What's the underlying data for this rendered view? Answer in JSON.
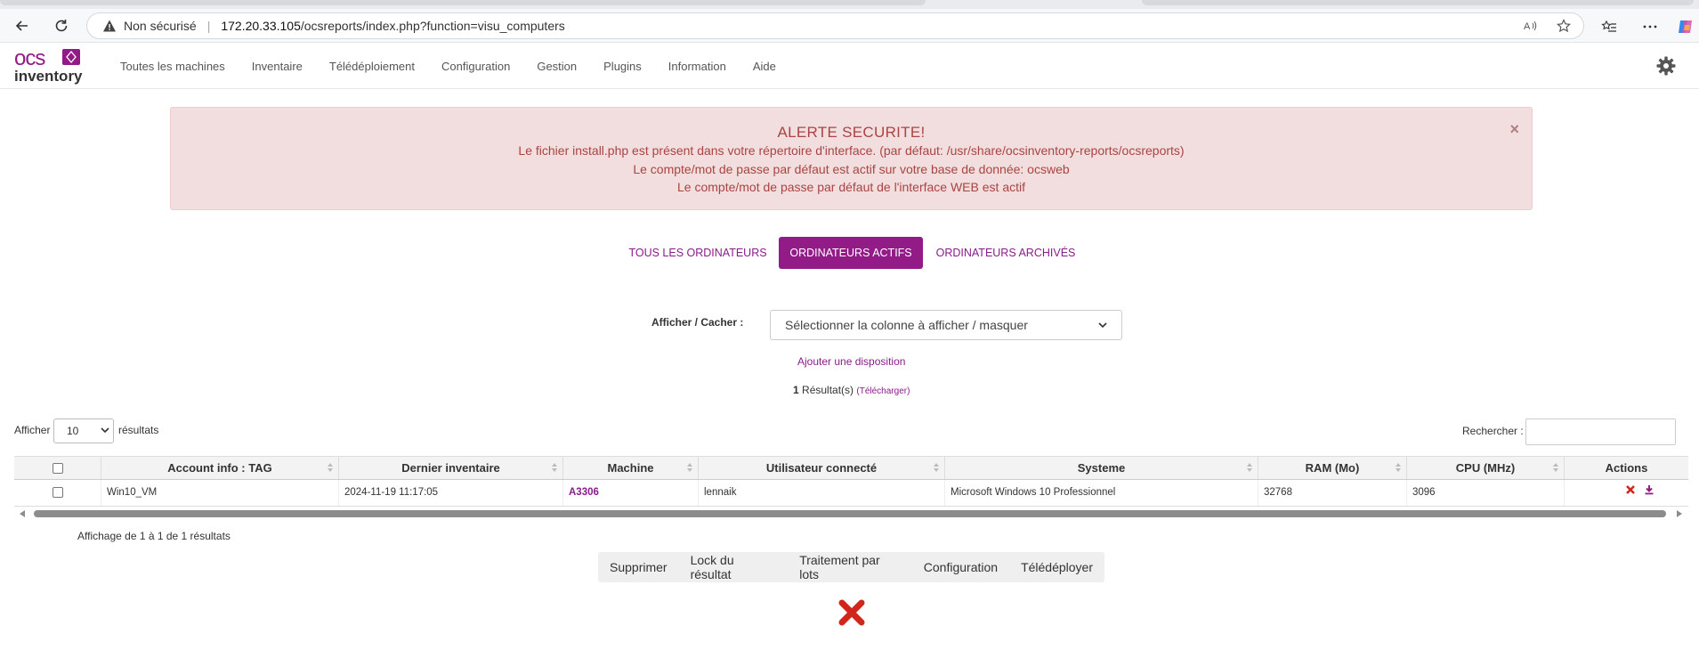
{
  "browser": {
    "insecure_label": "Non sécurisé",
    "url_host": "172.20.33.105",
    "url_path": "/ocsreports/index.php?function=visu_computers"
  },
  "app": {
    "logo_top": "ocs",
    "logo_bottom": "inventory",
    "accent": "#921b87",
    "nav": [
      {
        "label": "Toutes les machines"
      },
      {
        "label": "Inventaire"
      },
      {
        "label": "Télédéploiement"
      },
      {
        "label": "Configuration"
      },
      {
        "label": "Gestion"
      },
      {
        "label": "Plugins"
      },
      {
        "label": "Information"
      },
      {
        "label": "Aide"
      }
    ]
  },
  "alert": {
    "title": "ALERTE SECURITE!",
    "lines": [
      "Le fichier install.php est présent dans votre répertoire d'interface. (par défaut: /usr/share/ocsinventory-reports/ocsreports)",
      "Le compte/mot de passe par défaut est actif sur votre base de donnée: ocsweb",
      "Le compte/mot de passe par défaut de l'interface WEB est actif"
    ],
    "close": "×"
  },
  "tabs": [
    {
      "label": "TOUS LES ORDINATEURS",
      "active": false
    },
    {
      "label": "ORDINATEURS ACTIFS",
      "active": true
    },
    {
      "label": "ORDINATEURS ARCHIVÉS",
      "active": false
    }
  ],
  "filter": {
    "label": "Afficher / Cacher :",
    "select_value": "Sélectionner la colonne à afficher / masquer",
    "add_layout": "Ajouter une disposition"
  },
  "results": {
    "count": "1",
    "label": "Résultat(s)",
    "download": "(Télécharger)"
  },
  "table_controls": {
    "show_label": "Afficher",
    "show_value": "10",
    "show_suffix": "résultats",
    "search_label": "Rechercher :"
  },
  "table": {
    "headers": [
      "",
      "Account info : TAG",
      "Dernier inventaire",
      "Machine",
      "Utilisateur connecté",
      "Systeme",
      "RAM (Mo)",
      "CPU (MHz)",
      "Actions"
    ],
    "rows": [
      {
        "tag": "Win10_VM",
        "last_inventory": "2024-11-19 11:17:05",
        "machine": "A3306",
        "user": "lennaik",
        "system": "Microsoft Windows 10 Professionnel",
        "ram": "32768",
        "cpu": "3096"
      }
    ]
  },
  "info": "Affichage de 1 à 1 de 1 résultats",
  "bulk_actions": [
    "Supprimer",
    "Lock du résultat",
    "Traitement par lots",
    "Configuration",
    "Télédéployer"
  ]
}
